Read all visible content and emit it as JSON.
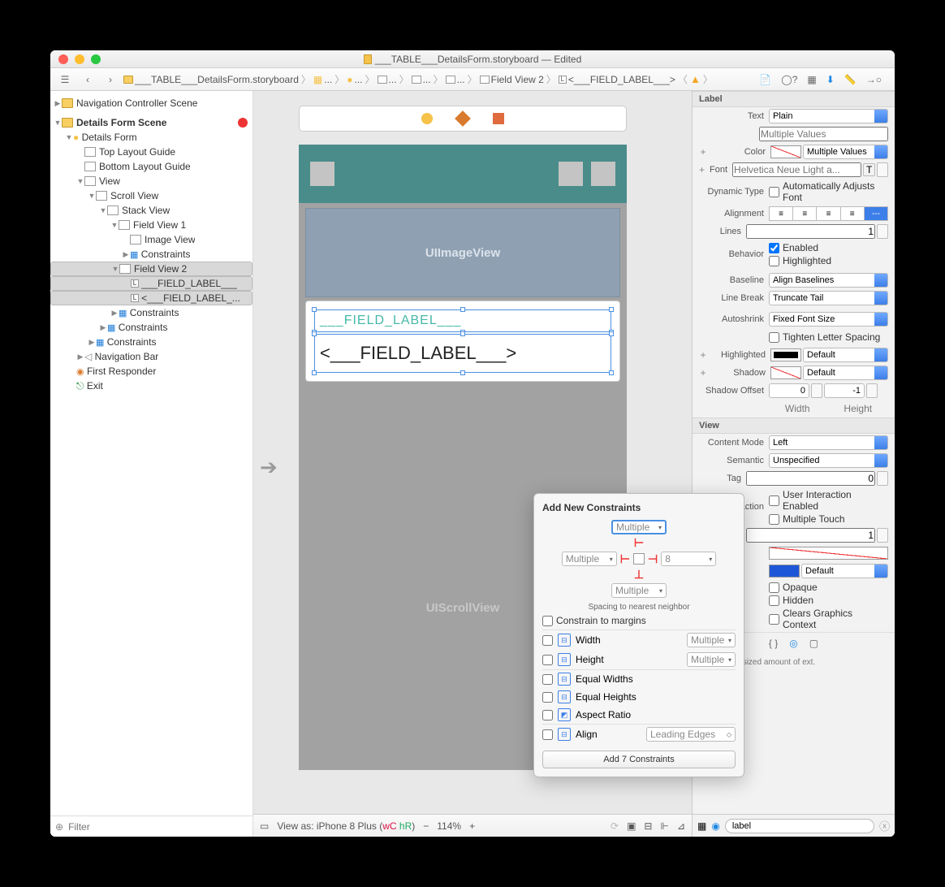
{
  "window": {
    "title": "___TABLE___DetailsForm.storyboard — Edited"
  },
  "breadcrumbs": [
    "___TABLE___DetailsForm.storyboard",
    "...",
    "...",
    "...",
    "...",
    "...",
    "Field View 2",
    "<___FIELD_LABEL___>"
  ],
  "outline": {
    "nav_scene": "Navigation Controller Scene",
    "details_scene": "Details Form Scene",
    "details_form": "Details Form",
    "top_guide": "Top Layout Guide",
    "bottom_guide": "Bottom Layout Guide",
    "view": "View",
    "scroll": "Scroll View",
    "stack": "Stack View",
    "fv1": "Field View 1",
    "imgv": "Image View",
    "constraints": "Constraints",
    "fv2": "Field View 2",
    "label1": "___FIELD_LABEL___",
    "label2": "<___FIELD_LABEL_...",
    "navbar": "Navigation Bar",
    "first_resp": "First Responder",
    "exit": "Exit"
  },
  "filter_placeholder": "Filter",
  "canvas": {
    "imgview": "UIImageView",
    "field1": "___FIELD_LABEL___",
    "field2": "<___FIELD_LABEL___>",
    "scroll": "UIScrollView"
  },
  "status": {
    "viewas": "View as: iPhone 8 Plus",
    "wc": "wC",
    "hr": "hR",
    "zoom": "114%"
  },
  "inspector": {
    "sect_label": "Label",
    "text": "Text",
    "text_v": "Plain",
    "text_ph": "Multiple Values",
    "color": "Color",
    "color_v": "Multiple Values",
    "font": "Font",
    "font_ph": "Helvetica Neue Light a...",
    "dyntype": "Dynamic Type",
    "dyntype_v": "Automatically Adjusts Font",
    "align": "Alignment",
    "lines": "Lines",
    "lines_v": "1",
    "behavior": "Behavior",
    "enabled": "Enabled",
    "highlighted": "Highlighted",
    "baseline": "Baseline",
    "baseline_v": "Align Baselines",
    "linebreak": "Line Break",
    "linebreak_v": "Truncate Tail",
    "autoshrink": "Autoshrink",
    "autoshrink_v": "Fixed Font Size",
    "tighten": "Tighten Letter Spacing",
    "highlighted2": "Highlighted",
    "default": "Default",
    "shadow": "Shadow",
    "shadow_off": "Shadow Offset",
    "width_l": "Width",
    "height_l": "Height",
    "w_v": "0",
    "h_v": "-1",
    "sect_view": "View",
    "contentmode": "Content Mode",
    "contentmode_v": "Left",
    "semantic": "Semantic",
    "semantic_v": "Unspecified",
    "tag": "Tag",
    "tag_v": "0",
    "interaction": "Interaction",
    "uie": "User Interaction Enabled",
    "mt": "Multiple Touch",
    "alpha_v": "1",
    "default2": "Default",
    "opaque": "Opaque",
    "hidden": "Hidden",
    "cgc": "Clears Graphics Context",
    "help": "- A variably sized amount of ext."
  },
  "popup": {
    "title": "Add New Constraints",
    "multiple": "Multiple",
    "right_v": "8",
    "note": "Spacing to nearest neighbor",
    "ctm": "Constrain to margins",
    "width": "Width",
    "height": "Height",
    "ew": "Equal Widths",
    "eh": "Equal Heights",
    "ar": "Aspect Ratio",
    "align": "Align",
    "align_v": "Leading Edges",
    "add": "Add 7 Constraints"
  },
  "library": {
    "search": "label"
  }
}
